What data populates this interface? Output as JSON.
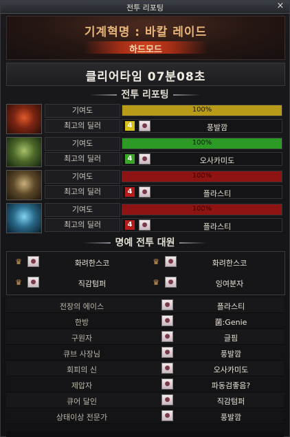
{
  "window": {
    "title": "전투 리포팅",
    "close": "×"
  },
  "header": {
    "raid_name": "기계혁명 : 바칼 레이드",
    "difficulty": "하드모드"
  },
  "clear_time": "클리어타임   07분08초",
  "report_section": {
    "title": "전투 리포팅"
  },
  "labels": {
    "contribution": "기여도",
    "best_dealer": "최고의 딜러"
  },
  "parties": [
    {
      "contribution": "100%",
      "bar_color": "#b89b18",
      "job_icon_color": "#d6c21a",
      "dealer_num": "4",
      "dealer": "풍발깜"
    },
    {
      "contribution": "100%",
      "bar_color": "#2d9a25",
      "job_icon_color": "#3aa52a",
      "dealer_num": "4",
      "dealer": "오사카미도"
    },
    {
      "contribution": "100%",
      "bar_color": "#8e1414",
      "job_icon_color": "#b51d1d",
      "dealer_num": "4",
      "dealer": "플라스티"
    },
    {
      "contribution": "100%",
      "bar_color": "#8e1414",
      "job_icon_color": "#b51d1d",
      "dealer_num": "4",
      "dealer": "플라스티"
    }
  ],
  "honor_section": {
    "title": "명예 전투 대원"
  },
  "honor": [
    "화려한스코",
    "화려한스코",
    "직감텀퍼",
    "잉여분자"
  ],
  "awards": [
    {
      "title": "전장의 에이스",
      "name": "플라스티"
    },
    {
      "title": "한방",
      "name": "菌:Genie"
    },
    {
      "title": "구원자",
      "name": "글핌"
    },
    {
      "title": "큐브 사장님",
      "name": "풍발깜"
    },
    {
      "title": "회피의 신",
      "name": "오사카미도"
    },
    {
      "title": "제압자",
      "name": "파동검좋음?"
    },
    {
      "title": "큐어 달인",
      "name": "직감텀퍼"
    },
    {
      "title": "상태이상 전문가",
      "name": "풍발깜"
    }
  ]
}
